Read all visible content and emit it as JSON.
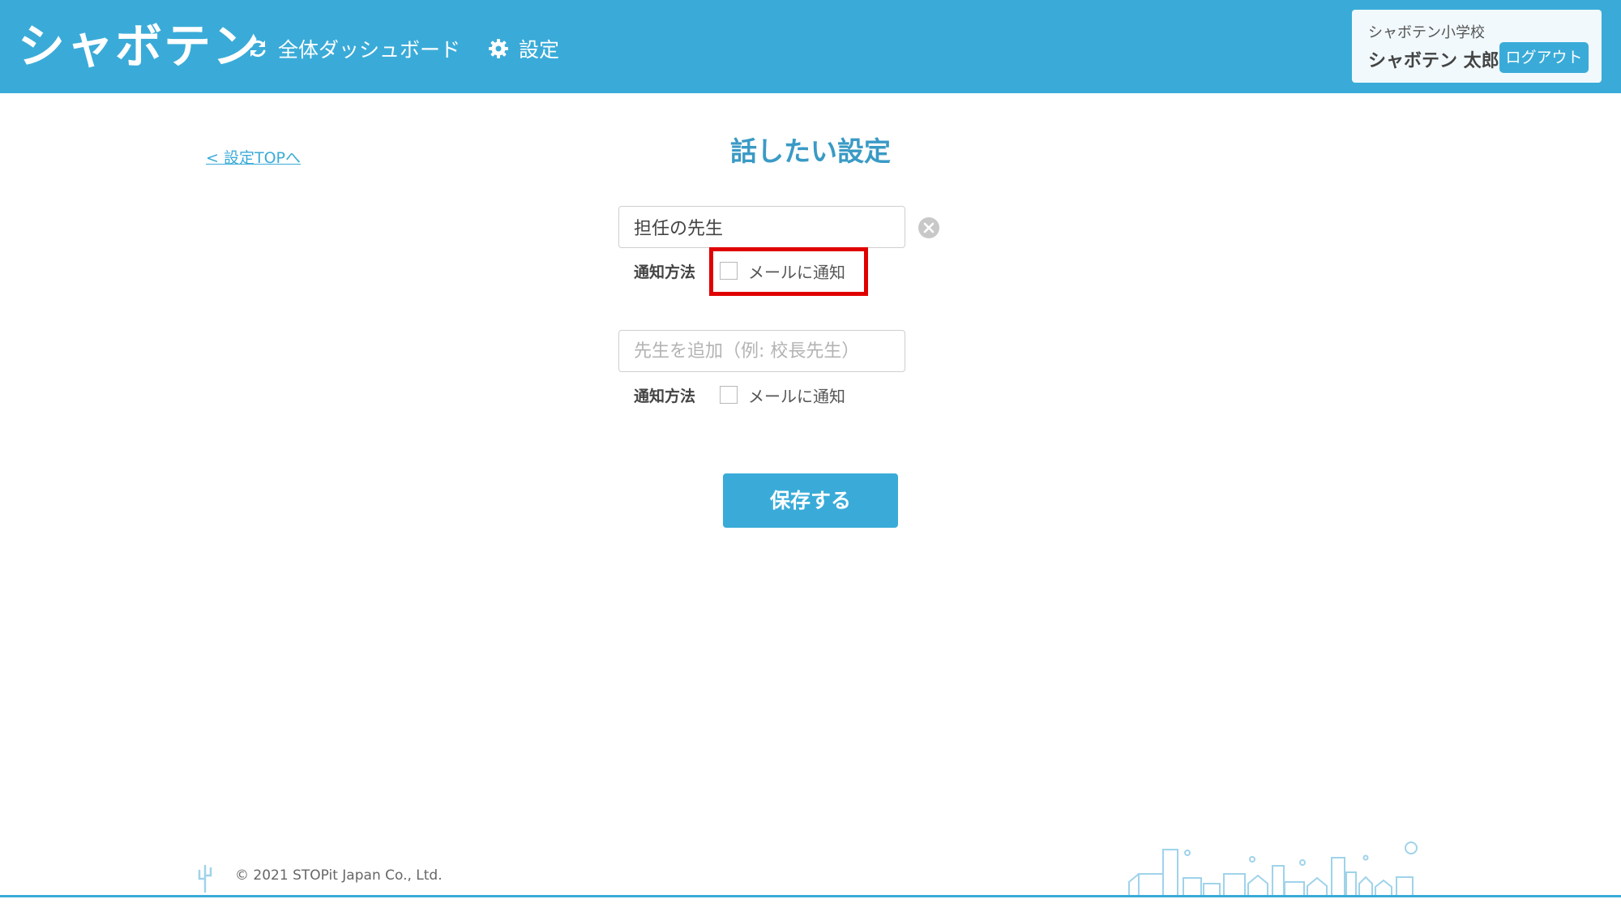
{
  "header": {
    "logo": "シャボテン",
    "nav": {
      "dashboard": "全体ダッシュボード",
      "settings": "設定"
    },
    "user": {
      "school": "シャボテン小学校",
      "name": "シャボテン 太郎",
      "logout": "ログアウト"
    }
  },
  "main": {
    "back_link": "< 設定TOPへ",
    "title": "話したい設定",
    "entries": [
      {
        "value": "担任の先生",
        "placeholder": "",
        "notify_label": "通知方法",
        "checkbox_label": "メールに通知",
        "checked": false
      },
      {
        "value": "",
        "placeholder": "先生を追加（例: 校長先生）",
        "notify_label": "通知方法",
        "checkbox_label": "メールに通知",
        "checked": false
      }
    ],
    "save_button": "保存する"
  },
  "footer": {
    "copyright": "© 2021 STOPit Japan Co., Ltd."
  },
  "colors": {
    "primary": "#3aabd8",
    "title": "#3a9ac5",
    "highlight": "#e00000"
  },
  "icons": [
    "refresh-icon",
    "gear-icon",
    "clear-icon",
    "cactus-icon"
  ]
}
